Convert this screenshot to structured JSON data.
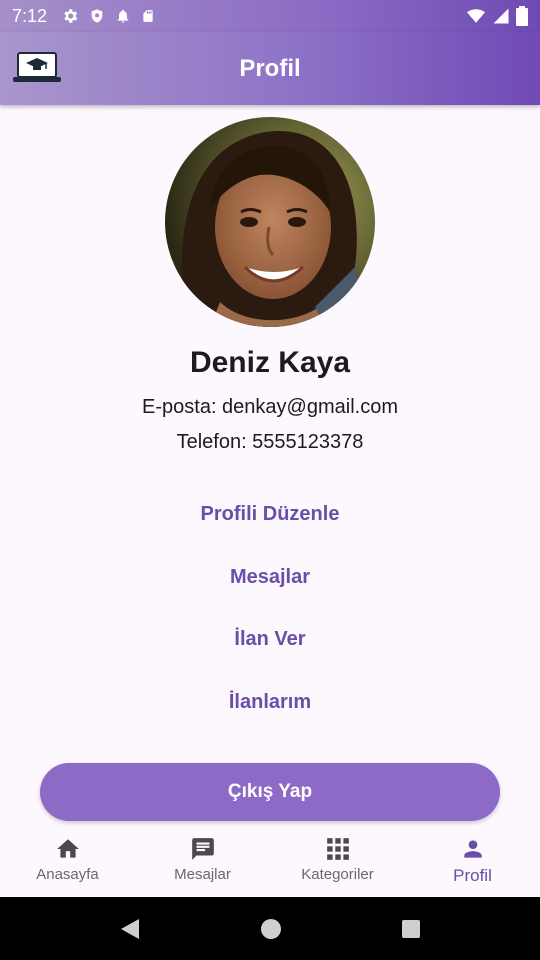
{
  "status": {
    "time": "7:12"
  },
  "app_bar": {
    "title": "Profil"
  },
  "profile": {
    "name": "Deniz Kaya",
    "email_line": "E-posta: denkay@gmail.com",
    "phone_line": "Telefon: 5555123378"
  },
  "actions": {
    "edit": "Profili Düzenle",
    "messages": "Mesajlar",
    "post_ad": "İlan Ver",
    "my_ads": "İlanlarım",
    "logout": "Çıkış Yap"
  },
  "bottom_nav": {
    "items": [
      {
        "label": "Anasayfa",
        "icon": "home-icon"
      },
      {
        "label": "Mesajlar",
        "icon": "chat-icon"
      },
      {
        "label": "Kategoriler",
        "icon": "grid-icon"
      },
      {
        "label": "Profil",
        "icon": "person-icon",
        "active": true
      }
    ]
  },
  "colors": {
    "accent": "#6a4ea8",
    "button": "#8c6ac6",
    "background": "#fdf7fe"
  }
}
